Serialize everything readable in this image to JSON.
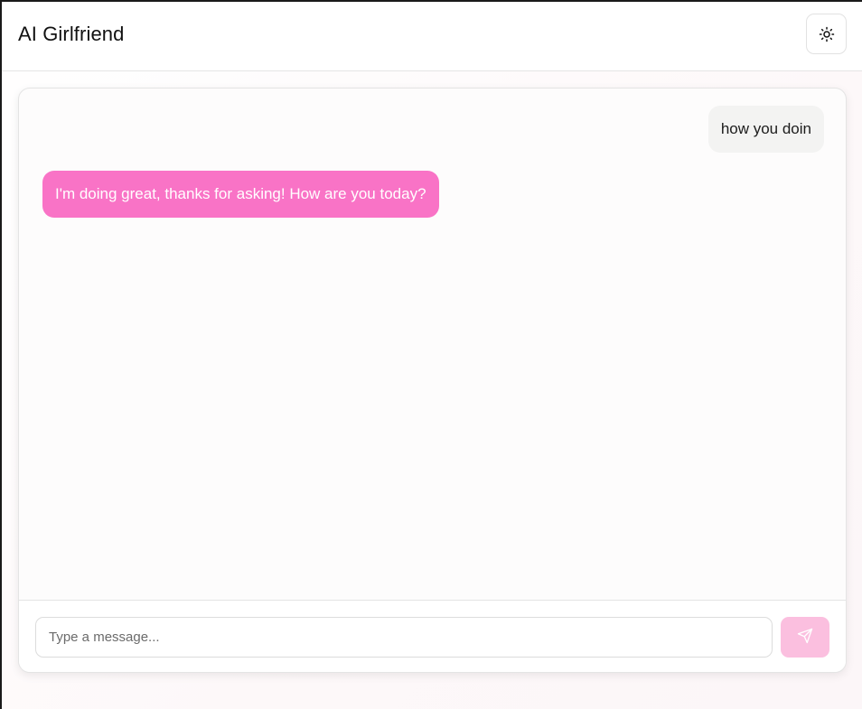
{
  "header": {
    "title": "AI Girlfriend",
    "theme_toggle_icon": "sun-icon"
  },
  "chat": {
    "messages": [
      {
        "role": "user",
        "text": "how you doin"
      },
      {
        "role": "assistant",
        "text": "I'm doing great, thanks for asking! How are you today?"
      }
    ]
  },
  "composer": {
    "input_value": "",
    "input_placeholder": "Type a message...",
    "send_icon": "send-icon"
  },
  "colors": {
    "accent": "#f973c6",
    "send_button_disabled": "#fbbfdf",
    "user_bubble": "#f3f3f2"
  }
}
